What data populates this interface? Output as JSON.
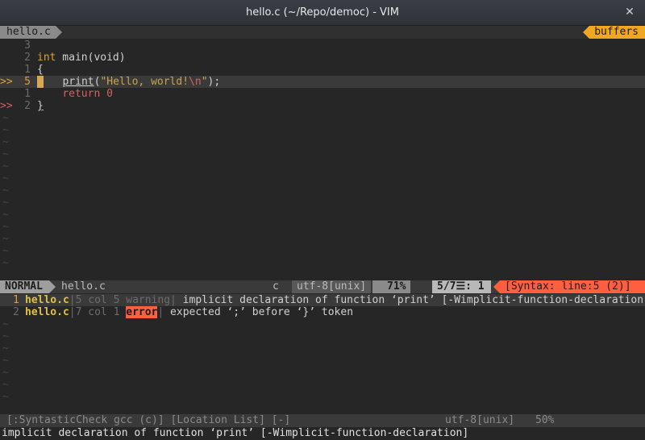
{
  "window": {
    "title": "hello.c (~/Repo/democ) - VIM",
    "close_icon": "✕"
  },
  "tabline": {
    "active_tab": "hello.c",
    "buffers_label": "buffers"
  },
  "editor": {
    "lines": [
      {
        "sign": "",
        "num": "3",
        "code_html": ""
      },
      {
        "sign": "",
        "num": "2",
        "code_html": "<span class=\"kw-type\">int</span> main(void)"
      },
      {
        "sign": "",
        "num": "1",
        "code_html": "{"
      },
      {
        "sign": ">>",
        "num": "5",
        "current": true,
        "code_html": "<span class=\"cursor\"></span>   <span class=\"fn-under\">print</span>(<span class=\"str\">\"Hello, world!<span class=\"esc\">\\n</span>\"</span>);"
      },
      {
        "sign": "",
        "num": "1",
        "code_html": "    <span class=\"kw\">return</span> <span class=\"num\">0</span>"
      },
      {
        "sign": ">>",
        "num": "2",
        "error": true,
        "code_html": "<span class=\"fn-under\">}</span>"
      }
    ],
    "tilde": "~"
  },
  "statusline": {
    "mode": "NORMAL",
    "file": "hello.c",
    "filetype": "c",
    "encoding": "utf-8[unix]",
    "percent": "71%",
    "position": "5/7☰:  1",
    "syntax": "[Syntax: line:5 (2)]"
  },
  "location_list": [
    {
      "index": "1",
      "file": "hello.c",
      "meta": "|5 col 5 warning|",
      "message": " implicit declaration of function ‘print’ [-Wimplicit-function-declaration]",
      "type": "warning"
    },
    {
      "index": "2",
      "file": "hello.c",
      "meta": "|7 col 1 ",
      "error_label": "error",
      "meta_end": "|",
      "message": " expected ‘;’ before ‘}’ token",
      "type": "error"
    }
  ],
  "statusline2": {
    "left": "[:SyntasticCheck gcc (c)] [Location List] [-]",
    "encoding": "utf-8[unix]",
    "percent": "50%"
  },
  "cmdline": {
    "text": "implicit declaration of function ‘print’ [-Wimplicit-function-declaration]"
  },
  "colors": {
    "accent_orange": "#f0a820",
    "error_red": "#ff5f3f",
    "background": "#262626"
  }
}
